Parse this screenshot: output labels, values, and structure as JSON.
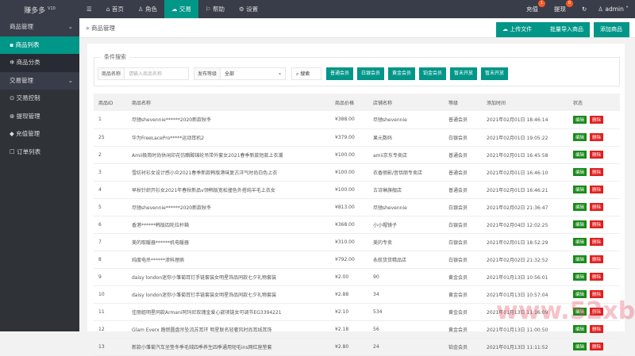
{
  "app": {
    "logo": "赚多多",
    "version": "V10"
  },
  "nav": [
    {
      "icon": "☰",
      "label": ""
    },
    {
      "icon": "⌂",
      "label": "首页"
    },
    {
      "icon": "♙",
      "label": "角色"
    },
    {
      "icon": "☁",
      "label": "交易"
    },
    {
      "icon": "⚐",
      "label": "帮助"
    },
    {
      "icon": "⚙",
      "label": "设置"
    }
  ],
  "topright": {
    "recharge": "充值",
    "recharge_count": "1",
    "withdraw": "提现",
    "withdraw_count": "0",
    "refresh": "↻",
    "user": "admin"
  },
  "sidebar": {
    "group1": "商品管理",
    "items1": [
      "商品列表",
      "商品分类"
    ],
    "group2": "交易管理",
    "items2": [
      "交易控制",
      "提现管理",
      "充值管理",
      "订单列表"
    ]
  },
  "breadcrumb": "商品管理",
  "toolbar": {
    "upload": "上传文件",
    "import": "批量导入商品",
    "add": "添加商品"
  },
  "search": {
    "legend": "条件搜索",
    "name_label": "商品名称",
    "name_placeholder": "请输入商品名称",
    "level_label": "发布等级",
    "level_value": "全部",
    "search_btn": "搜索",
    "filters": [
      "普通会员",
      "白银会员",
      "黄金会员",
      "铂金会员",
      "暂未开放",
      "暂未开放"
    ]
  },
  "table": {
    "headers": [
      "商品ID",
      "商品名称",
      "商品价格",
      "店铺名称",
      "等级",
      "添加时间",
      "状态"
    ],
    "edit": "编辑",
    "delete": "删除",
    "rows": [
      [
        "1",
        "尽驰shevennie******2020新款秋冬",
        "¥388.00",
        "尽驰shevennie",
        "普通会员",
        "2021年02月01日 18:46:14"
      ],
      [
        "25",
        "华为FreeLacePro*****运动耳机2",
        "¥379.00",
        "果元数码",
        "白银会员",
        "2021年02月01日 19:05:22"
      ],
      [
        "2",
        "Amii极简时尚休闲印花仿醋酸锦纶吊带外套女2021春季新款短款上衣潮",
        "¥100.00",
        "amii京东专卖店",
        "普通会员",
        "2021年02月01日 16:45:58"
      ],
      [
        "3",
        "雪纺衬衫女设计感小众2021春季新款韩版港味复古洋气时尚白色上衣",
        "¥100.00",
        "衣香丽影/音恬丽专卖店",
        "普通会员",
        "2021年02月01日 16:46:10"
      ],
      [
        "4",
        "早秋针织开衫女2021年春秋新品v领韩版宽松撞色外搭纯羊毛上衣女",
        "¥100.00",
        "古诗琳旗舰店",
        "普通会员",
        "2021年02月01日 16:46:21"
      ],
      [
        "5",
        "尽驰shevennie******2020新款秋冬",
        "¥813.00",
        "尽驰shevennie",
        "白银会员",
        "2021年02月02日 21:36:47"
      ],
      [
        "6",
        "香港******韩版四轮拉杆箱",
        "¥368.00",
        "小小帽镜子",
        "白银会员",
        "2021年02月04日 12:02:25"
      ],
      [
        "7",
        "美的取暖器******机电暖器",
        "¥310.00",
        "美的专卖",
        "白银会员",
        "2021年02月01日 18:52:29"
      ],
      [
        "8",
        "纯度电杀******渗科理病",
        "¥792.00",
        "永航货货精品店",
        "白银会员",
        "2021年02月02日 21:32:52"
      ],
      [
        "9",
        "daisy london迷你小雏菊耳钉手链套装女明星饰品同款七夕礼物套装",
        "¥2.00",
        "90",
        "黄金会员",
        "2021年01月13日 10:56:01"
      ],
      [
        "10",
        "daisy london迷你小雏菊耳钉手链套装女明星饰品同款七夕礼物套装",
        "¥2.88",
        "34",
        "黄金会员",
        "2021年01月13日 10:57:04"
      ],
      [
        "11",
        "佳丽姐明星同款Armani阿玛尼玫瑰金爱心嵌项链女可调节EG3394221",
        "¥2.10",
        "534",
        "黄金会员",
        "2021年01月13日 11:16:09"
      ],
      [
        "12",
        "Glam Everx 踏燃圆盘吊坠流苏耳环 明星联名轻奢风时尚耳线耳饰",
        "¥2.18",
        "56",
        "黄金会员",
        "2021年01月13日 11:00:50"
      ],
      [
        "13",
        "新款小雏菊汽车坐垫冬季毛绒四季养生四季通用短毛ins网红座垫套",
        "¥2.80",
        "24",
        "铂金会员",
        "2021年01月13日 11:11:52"
      ]
    ]
  },
  "watermark": "www.52xb.cn",
  "colors": {
    "accent": "#009688",
    "edit": "#1a8a1a",
    "delete": "#e02020"
  }
}
